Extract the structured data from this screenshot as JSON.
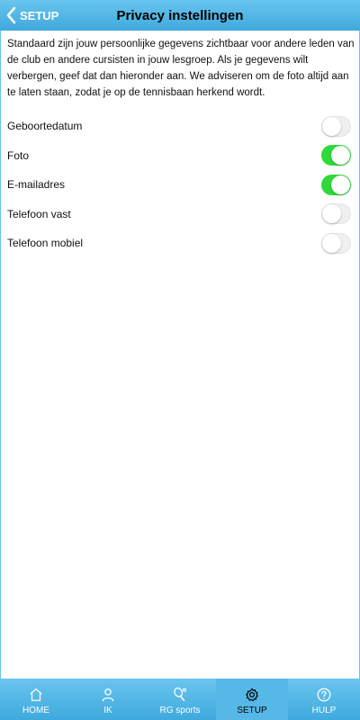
{
  "header": {
    "back_label": "SETUP",
    "title": "Privacy instellingen"
  },
  "intro": "Standaard zijn jouw persoonlijke gegevens zichtbaar voor andere leden van de club en andere cursisten in jouw lesgroep. Als je gegevens wilt verbergen, geef dat dan hieronder aan. We adviseren om de foto altijd aan te laten staan, zodat je op de tennisbaan herkend wordt.",
  "settings": [
    {
      "label": "Geboortedatum",
      "on": false
    },
    {
      "label": "Foto",
      "on": true
    },
    {
      "label": "E-mailadres",
      "on": true
    },
    {
      "label": "Telefoon vast",
      "on": false
    },
    {
      "label": "Telefoon mobiel",
      "on": false
    }
  ],
  "tabs": [
    {
      "label": "HOME",
      "icon": "home-icon",
      "active": false
    },
    {
      "label": "IK",
      "icon": "user-icon",
      "active": false
    },
    {
      "label": "RG sports",
      "icon": "tennis-racket-icon",
      "active": false
    },
    {
      "label": "SETUP",
      "icon": "gear-icon",
      "active": true
    },
    {
      "label": "HULP",
      "icon": "help-icon",
      "active": false
    }
  ],
  "colors": {
    "header": "#3fa9dd",
    "toggle_on": "#2fd93c",
    "toggle_off": "#efefef"
  }
}
